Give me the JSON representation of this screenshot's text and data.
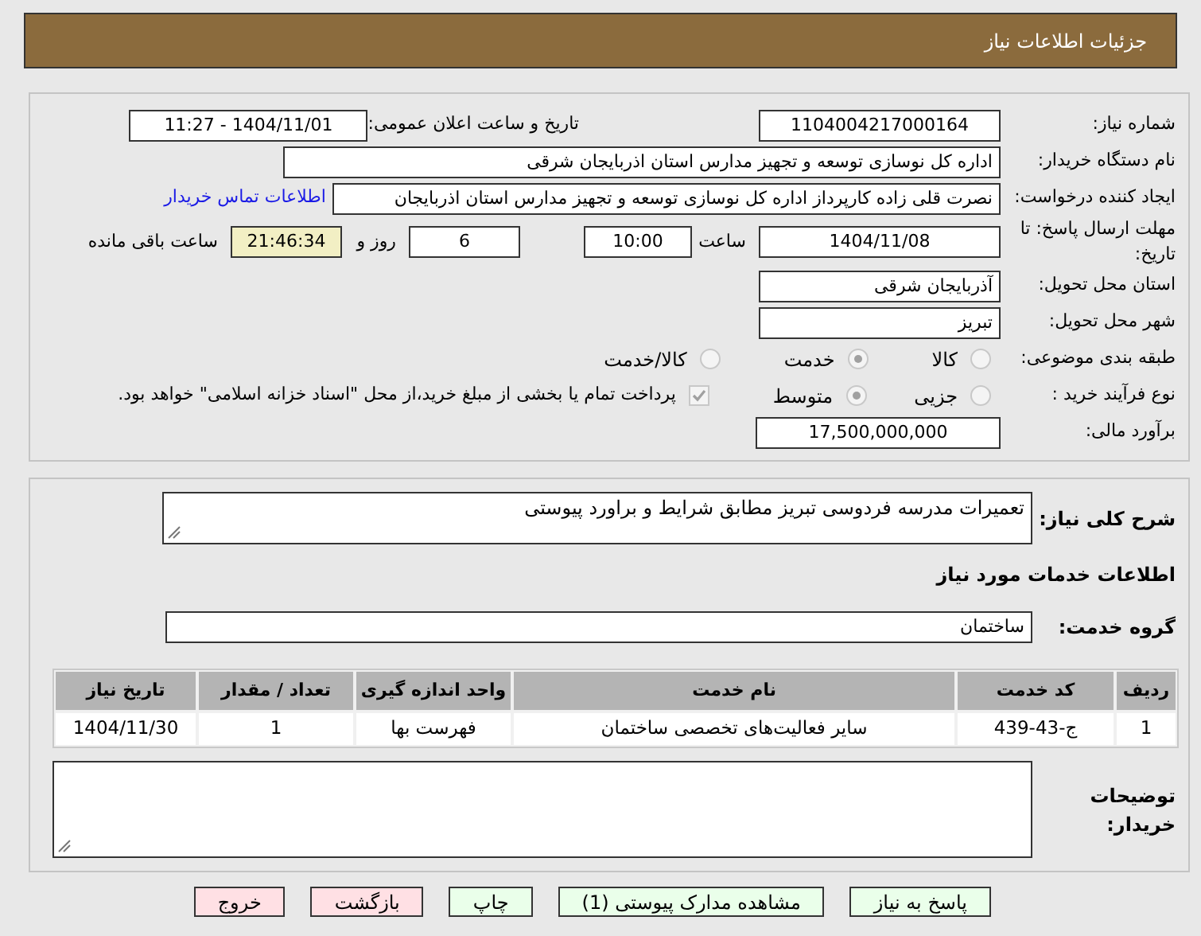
{
  "header": {
    "title": "جزئیات اطلاعات نیاز"
  },
  "details": {
    "need_number": {
      "label": "شماره نیاز:",
      "value": "1104004217000164"
    },
    "announce": {
      "label": "تاریخ و ساعت اعلان عمومی:",
      "value": "1404/11/01 - 11:27"
    },
    "buyer": {
      "label": "نام دستگاه خریدار:",
      "value": "اداره کل نوسازی  توسعه و تجهیز مدارس استان اذربایجان شرقی"
    },
    "creator": {
      "label": "ایجاد کننده درخواست:",
      "value": "نصرت قلی زاده کارپرداز اداره کل نوسازی  توسعه و تجهیز مدارس استان اذربایجان",
      "link": "اطلاعات تماس خریدار"
    },
    "deadline": {
      "label": "مهلت ارسال پاسخ: تا تاریخ:",
      "date": "1404/11/08",
      "time_label": "ساعت",
      "time": "10:00",
      "days": "6",
      "days_label": "روز و",
      "remaining": "21:46:34",
      "remaining_label": "ساعت باقی مانده"
    },
    "province": {
      "label": "استان محل تحویل:",
      "value": "آذربایجان شرقی"
    },
    "city": {
      "label": "شهر محل تحویل:",
      "value": "تبریز"
    },
    "category": {
      "label": "طبقه بندی موضوعی:",
      "options": [
        {
          "label": "کالا",
          "selected": false
        },
        {
          "label": "خدمت",
          "selected": true
        },
        {
          "label": "کالا/خدمت",
          "selected": false
        }
      ]
    },
    "process": {
      "label": "نوع فرآیند خرید :",
      "options": [
        {
          "label": "جزیی",
          "selected": false
        },
        {
          "label": "متوسط",
          "selected": true
        }
      ],
      "treasury": {
        "checked": true,
        "text": "پرداخت تمام یا بخشی از مبلغ خرید،از محل \"اسناد خزانه اسلامی\" خواهد بود."
      }
    },
    "budget": {
      "label": "برآورد مالی:",
      "value": "17,500,000,000"
    }
  },
  "needs": {
    "description": {
      "label": "شرح کلی نیاز:",
      "value": "تعمیرات مدرسه فردوسی تبریز مطابق شرایط و براورد پیوستی"
    },
    "services_title": "اطلاعات خدمات مورد نیاز",
    "service_group": {
      "label": "گروه خدمت:",
      "value": "ساختمان"
    },
    "table": {
      "columns": [
        "ردیف",
        "کد خدمت",
        "نام خدمت",
        "واحد اندازه گیری",
        "تعداد / مقدار",
        "تاریخ نیاز"
      ],
      "rows": [
        [
          "1",
          "ج-43-439",
          "سایر فعالیت‌های تخصصی ساختمان",
          "فهرست بها",
          "1",
          "1404/11/30"
        ]
      ]
    },
    "buyer_notes": {
      "label": "توضیحات خریدار:"
    }
  },
  "buttons": [
    {
      "label": "پاسخ به نیاز",
      "kind": "action"
    },
    {
      "label": "مشاهده مدارک پیوستی (1)",
      "kind": "action"
    },
    {
      "label": "چاپ",
      "kind": "action"
    },
    {
      "label": "بازگشت",
      "kind": "danger"
    },
    {
      "label": "خروج",
      "kind": "danger"
    }
  ]
}
